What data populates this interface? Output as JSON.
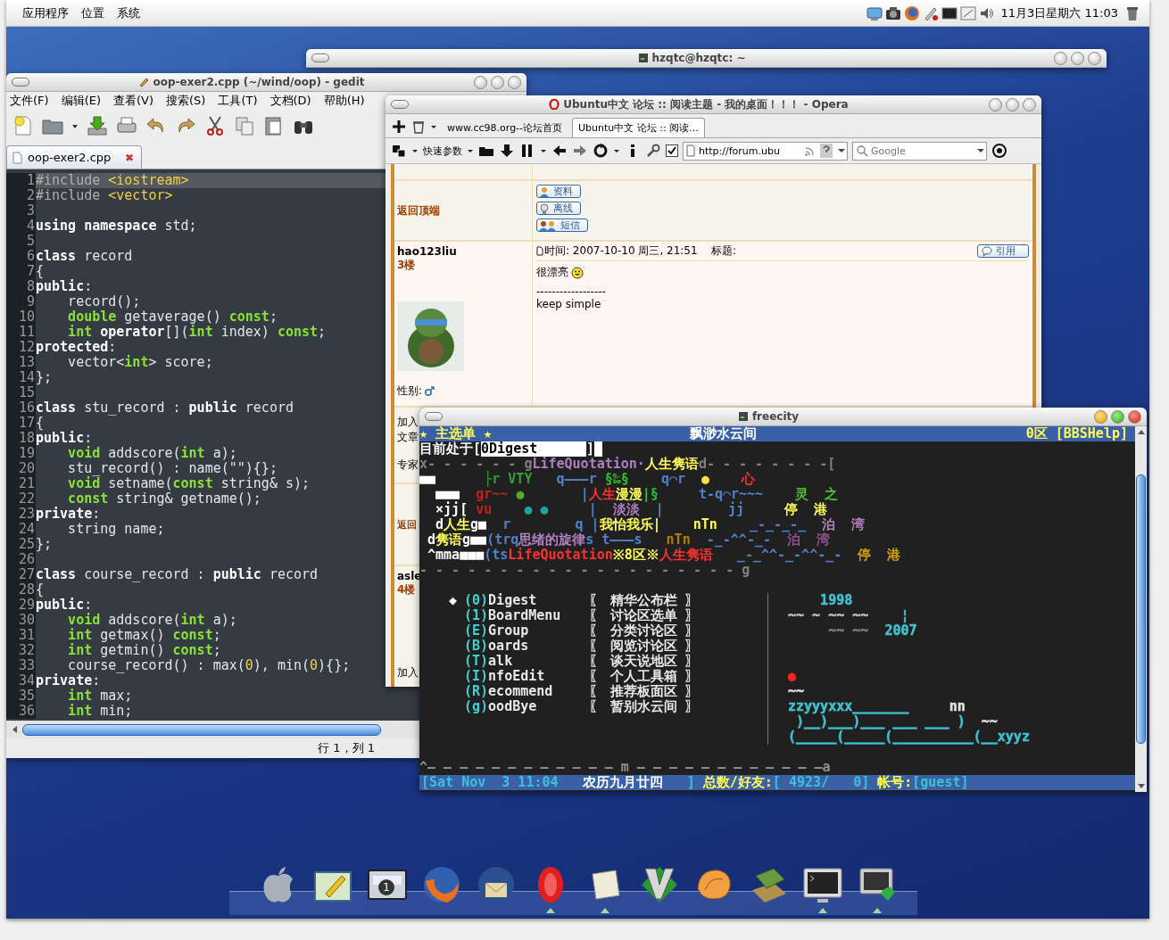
{
  "top_panel": {
    "menus": [
      "应用程序",
      "位置",
      "系统"
    ],
    "clock": "11月3日星期六 11:03"
  },
  "back_terminal": {
    "title": "hzqtc@hzqtc: ~"
  },
  "gedit": {
    "title": "oop-exer2.cpp (~/wind/oop) - gedit",
    "menus": [
      "文件(F)",
      "编辑(E)",
      "查看(V)",
      "搜索(S)",
      "工具(T)",
      "文档(D)",
      "帮助(H)"
    ],
    "tab": {
      "label": "oop-exer2.cpp",
      "close": "✖"
    },
    "lines": [
      {
        "number": "1",
        "segments": [
          {
            "text": "#include ",
            "kind": "preproc"
          },
          {
            "text": "<iostream>",
            "kind": "header"
          }
        ]
      },
      {
        "number": "2",
        "segments": [
          {
            "text": "#include ",
            "kind": "preproc"
          },
          {
            "text": "<vector>",
            "kind": "header"
          }
        ]
      },
      {
        "number": "3"
      },
      {
        "number": "4",
        "segments": [
          {
            "text": "using namespace",
            "kind": "keyword"
          },
          {
            "text": " std;",
            "kind": "plain"
          }
        ]
      },
      {
        "number": "5"
      },
      {
        "number": "6",
        "segments": [
          {
            "text": "class",
            "kind": "keyword"
          },
          {
            "text": " record",
            "kind": "plain"
          }
        ]
      },
      {
        "number": "7",
        "segments": [
          {
            "text": "{",
            "kind": "plain"
          }
        ]
      },
      {
        "number": "8",
        "segments": [
          {
            "text": "public",
            "kind": "keyword"
          },
          {
            "text": ":",
            "kind": "plain"
          }
        ]
      },
      {
        "number": "9",
        "segments": [
          {
            "text": "    record();",
            "kind": "plain"
          }
        ]
      },
      {
        "number": "10",
        "segments": [
          {
            "text": "    double",
            "kind": "type"
          },
          {
            "text": " getaverage() ",
            "kind": "plain"
          },
          {
            "text": "const",
            "kind": "type"
          },
          {
            "text": ";",
            "kind": "plain"
          }
        ]
      },
      {
        "number": "11",
        "segments": [
          {
            "text": "    int",
            "kind": "type"
          },
          {
            "text": " operator",
            "kind": "keyword"
          },
          {
            "text": "[](",
            "kind": "plain"
          },
          {
            "text": "int",
            "kind": "type"
          },
          {
            "text": " index) ",
            "kind": "plain"
          },
          {
            "text": "const",
            "kind": "type"
          },
          {
            "text": ";",
            "kind": "plain"
          }
        ]
      },
      {
        "number": "12",
        "segments": [
          {
            "text": "protected",
            "kind": "keyword"
          },
          {
            "text": ":",
            "kind": "plain"
          }
        ]
      },
      {
        "number": "13",
        "segments": [
          {
            "text": "    vector<",
            "kind": "plain"
          },
          {
            "text": "int",
            "kind": "type"
          },
          {
            "text": "> score;",
            "kind": "plain"
          }
        ]
      },
      {
        "number": "14",
        "segments": [
          {
            "text": "};",
            "kind": "plain"
          }
        ]
      },
      {
        "number": "15"
      },
      {
        "number": "16",
        "segments": [
          {
            "text": "class",
            "kind": "keyword"
          },
          {
            "text": " stu_record : ",
            "kind": "plain"
          },
          {
            "text": "public",
            "kind": "keyword"
          },
          {
            "text": " record",
            "kind": "plain"
          }
        ]
      },
      {
        "number": "17",
        "segments": [
          {
            "text": "{",
            "kind": "plain"
          }
        ]
      },
      {
        "number": "18",
        "segments": [
          {
            "text": "public",
            "kind": "keyword"
          },
          {
            "text": ":",
            "kind": "plain"
          }
        ]
      },
      {
        "number": "19",
        "segments": [
          {
            "text": "    void",
            "kind": "type"
          },
          {
            "text": " addscore(",
            "kind": "plain"
          },
          {
            "text": "int",
            "kind": "type"
          },
          {
            "text": " a);",
            "kind": "plain"
          }
        ]
      },
      {
        "number": "20",
        "segments": [
          {
            "text": "    stu_record() : name(\"\"){};",
            "kind": "plain"
          }
        ]
      },
      {
        "number": "21",
        "segments": [
          {
            "text": "    void",
            "kind": "type"
          },
          {
            "text": " setname(",
            "kind": "plain"
          },
          {
            "text": "const",
            "kind": "type"
          },
          {
            "text": " string& s);",
            "kind": "plain"
          }
        ]
      },
      {
        "number": "22",
        "segments": [
          {
            "text": "    const",
            "kind": "type"
          },
          {
            "text": " string& getname();",
            "kind": "plain"
          }
        ]
      },
      {
        "number": "23",
        "segments": [
          {
            "text": "private",
            "kind": "keyword"
          },
          {
            "text": ":",
            "kind": "plain"
          }
        ]
      },
      {
        "number": "24",
        "segments": [
          {
            "text": "    string name;",
            "kind": "plain"
          }
        ]
      },
      {
        "number": "25",
        "segments": [
          {
            "text": "};",
            "kind": "plain"
          }
        ]
      },
      {
        "number": "26"
      },
      {
        "number": "27",
        "segments": [
          {
            "text": "class",
            "kind": "keyword"
          },
          {
            "text": " course_record : ",
            "kind": "plain"
          },
          {
            "text": "public",
            "kind": "keyword"
          },
          {
            "text": " record",
            "kind": "plain"
          }
        ]
      },
      {
        "number": "28",
        "segments": [
          {
            "text": "{",
            "kind": "plain"
          }
        ]
      },
      {
        "number": "29",
        "segments": [
          {
            "text": "public",
            "kind": "keyword"
          },
          {
            "text": ":",
            "kind": "plain"
          }
        ]
      },
      {
        "number": "30",
        "segments": [
          {
            "text": "    void",
            "kind": "type"
          },
          {
            "text": " addscore(",
            "kind": "plain"
          },
          {
            "text": "int",
            "kind": "type"
          },
          {
            "text": " a);",
            "kind": "plain"
          }
        ]
      },
      {
        "number": "31",
        "segments": [
          {
            "text": "    int",
            "kind": "type"
          },
          {
            "text": " getmax() ",
            "kind": "plain"
          },
          {
            "text": "const",
            "kind": "type"
          },
          {
            "text": ";",
            "kind": "plain"
          }
        ]
      },
      {
        "number": "32",
        "segments": [
          {
            "text": "    int",
            "kind": "type"
          },
          {
            "text": " getmin() ",
            "kind": "plain"
          },
          {
            "text": "const",
            "kind": "type"
          },
          {
            "text": ";",
            "kind": "plain"
          }
        ]
      },
      {
        "number": "33",
        "segments": [
          {
            "text": "    course_record() : max(",
            "kind": "plain"
          },
          {
            "text": "0",
            "kind": "number"
          },
          {
            "text": "), min(",
            "kind": "plain"
          },
          {
            "text": "0",
            "kind": "number"
          },
          {
            "text": "){};",
            "kind": "plain"
          }
        ]
      },
      {
        "number": "34",
        "segments": [
          {
            "text": "private",
            "kind": "keyword"
          },
          {
            "text": ":",
            "kind": "plain"
          }
        ]
      },
      {
        "number": "35",
        "segments": [
          {
            "text": "    int",
            "kind": "type"
          },
          {
            "text": " max;",
            "kind": "plain"
          }
        ]
      },
      {
        "number": "36",
        "segments": [
          {
            "text": "    int",
            "kind": "type"
          },
          {
            "text": " min;",
            "kind": "plain"
          }
        ]
      }
    ],
    "status": {
      "position": "行 1，列 1"
    }
  },
  "opera": {
    "title": "Ubuntu中文 论坛 :: 阅读主题 - 我的桌面！！！ - Opera",
    "tabs": [
      {
        "label": "www.cc98.org--论坛首页",
        "selected": false
      },
      {
        "label": "Ubuntu中文 论坛 :: 阅读...",
        "selected": true
      }
    ],
    "quick_prefs": "快速参数",
    "checkbox_checked": true,
    "address": "http://forum.ubu",
    "search_placeholder": "Google",
    "back_to_top": "返回顶端",
    "profile_buttons": [
      "资料",
      "离线",
      "短信"
    ],
    "post": {
      "author": "hao123liu",
      "floor": "3楼",
      "gender_label": "性别:",
      "header": "时间: 2007-10-10 周三, 21:51    标题:",
      "quote": "引用",
      "body": "很漂亮",
      "signature_rule": "------------------",
      "signature": "keep simple"
    },
    "left_fragments": [
      "加入",
      "文章",
      "专家"
    ],
    "back_to_top_cut": "返回",
    "next_author": "asle",
    "next_floor": "4楼",
    "joined_cut": "加入"
  },
  "bbs": {
    "title": "freecity",
    "header": {
      "left": "★ 主选单 ★",
      "center": "飘渺水云间",
      "right": "0区 [BBSHelp]"
    },
    "location": {
      "prefix": "目前处于[",
      "value": "0Digest",
      "suffix": "]"
    },
    "art_lines": [
      [
        {
          "text": "x- - - - - - g",
          "color": "#808080"
        },
        {
          "text": "LifeQuotation·",
          "color": "#b080c0"
        },
        {
          "text": "人生隽语",
          "color": "#ffff55"
        },
        {
          "text": "d- - - - - - - -[",
          "color": "#808080"
        }
      ],
      [
        {
          "text": "■■      ",
          "color": "#ffffff"
        },
        {
          "text": "├r VTY   ",
          "color": "#30a030"
        },
        {
          "text": "q———r ",
          "color": "#5080d0"
        },
        {
          "text": "§‰§    ",
          "color": "#30c030"
        },
        {
          "text": "q⌒r  ",
          "color": "#5080d0"
        },
        {
          "text": "●    ",
          "color": "#ffe040"
        },
        {
          "text": "心",
          "color": "#ff3030"
        }
      ],
      [
        {
          "text": "  ■■■  ",
          "color": "#ffffff"
        },
        {
          "text": "gr~~ ",
          "color": "#c02020"
        },
        {
          "text": "●       ",
          "color": "#50b020"
        },
        {
          "text": "|",
          "color": "#5080d0"
        },
        {
          "text": "人生",
          "color": "#ff3030"
        },
        {
          "text": "漫漫",
          "color": "#ffff55"
        },
        {
          "text": "|§     ",
          "color": "#30c030"
        },
        {
          "text": "t-q⌒r~~~    ",
          "color": "#5080d0"
        },
        {
          "text": "灵  之",
          "color": "#50c030"
        }
      ],
      [
        {
          "text": "  ×jj[ ",
          "color": "#ffffff"
        },
        {
          "text": "vu    ",
          "color": "#c02020"
        },
        {
          "text": "● ●     ",
          "color": "#20a0a0"
        },
        {
          "text": "|  ",
          "color": "#5080d0"
        },
        {
          "text": "淡淡  ",
          "color": "#b080c0"
        },
        {
          "text": "|        jj     ",
          "color": "#5080d0"
        },
        {
          "text": "停  港",
          "color": "#ffff55"
        }
      ],
      [
        {
          "text": "  d",
          "color": "#ffffff"
        },
        {
          "text": "人生",
          "color": "#ffff55"
        },
        {
          "text": "g■  ",
          "color": "#ffffff"
        },
        {
          "text": "r        q |",
          "color": "#5080d0"
        },
        {
          "text": "我怡我乐",
          "color": "#ffff55"
        },
        {
          "text": "|    nTn    ",
          "color": "#ffff55"
        },
        {
          "text": "_-_-_-_  ",
          "color": "#5080d0"
        },
        {
          "text": "泊  湾",
          "color": "#b080c0"
        }
      ],
      [
        {
          "text": " d",
          "color": "#ffffff"
        },
        {
          "text": "隽语",
          "color": "#ffff55"
        },
        {
          "text": "g■■",
          "color": "#ffffff"
        },
        {
          "text": "(trq",
          "color": "#5080d0"
        },
        {
          "text": "思绪的旋律",
          "color": "#b080c0"
        },
        {
          "text": "s t———s   ",
          "color": "#5080d0"
        },
        {
          "text": "nTn  ",
          "color": "#b08000"
        },
        {
          "text": "-_-^^-_-  ",
          "color": "#5080d0"
        },
        {
          "text": "泊  湾",
          "color": "#905090"
        }
      ],
      [
        {
          "text": " ^mma■■■",
          "color": "#ffffff"
        },
        {
          "text": "(ts",
          "color": "#5080d0"
        },
        {
          "text": "LifeQuotation",
          "color": "#ff3030"
        },
        {
          "text": "※8区※",
          "color": "#ffff55"
        },
        {
          "text": "人生隽语",
          "color": "#ff3030"
        },
        {
          "text": "   _-_^^-_-^^-_-  ",
          "color": "#5080d0"
        },
        {
          "text": "停  港",
          "color": "#d0a000"
        }
      ],
      [
        {
          "text": "- - - - - - - - - - - - - - - - - - - - g",
          "color": "#808080"
        }
      ]
    ],
    "menu_marker": "◆",
    "menu": [
      {
        "key": "(0)",
        "label": "Digest",
        "description": "〖 精华公布栏 〗",
        "selected": true,
        "art": [
          {
            "text": "    1998",
            "color": "#40c0d0"
          }
        ]
      },
      {
        "key": "(1)",
        "label": "BoardMenu",
        "description": "〖 讨论区选单 〗",
        "selected": false,
        "art": [
          {
            "text": "~~ ~ ~~ ~~    ",
            "color": "#c0c0c0"
          },
          {
            "text": "¦",
            "color": "#40c0d0"
          }
        ]
      },
      {
        "key": "(E)",
        "label": "Group",
        "description": "〖 分类讨论区 〗",
        "selected": false,
        "art": [
          {
            "text": "     ~~ ~~  ",
            "color": "#808080"
          },
          {
            "text": "2007",
            "color": "#40c0d0"
          }
        ]
      },
      {
        "key": "(B)",
        "label": "oards",
        "description": "〖 阅览讨论区 〗",
        "selected": false
      },
      {
        "key": "(T)",
        "label": "alk",
        "description": "〖 谈天说地区 〗",
        "selected": false
      },
      {
        "key": "(I)",
        "label": "nfoEdit",
        "description": "〖 个人工具箱 〗",
        "selected": false,
        "art": [
          {
            "text": "●",
            "color": "#ff2020"
          }
        ]
      },
      {
        "key": "(R)",
        "label": "ecommend",
        "description": "〖 推荐板面区 〗",
        "selected": false,
        "art": [
          {
            "text": "~~",
            "color": "#e0e0e0"
          }
        ]
      },
      {
        "key": "(g)",
        "label": "oodBye",
        "description": "〖 暂别水云间 〗",
        "selected": false,
        "art": [
          {
            "text": "zzyyyxxx_______     ",
            "color": "#40c0d0"
          },
          {
            "text": "nn",
            "color": "#e0e0e0"
          }
        ]
      }
    ],
    "footer_art": [
      [
        {
          "text": " )__)___)___ ___ ___ )  ",
          "color": "#40c0d0"
        },
        {
          "text": "~~",
          "color": "#e0e0e0"
        }
      ],
      [
        {
          "text": "(_____(_____(__________(__xyyz",
          "color": "#40c0d0"
        }
      ]
    ],
    "divider": "^— — — — — — — — — — — — m — — — — — — — — — — — —a",
    "status": [
      {
        "text": "[Sat Nov  3 11:04",
        "kind": "value"
      },
      {
        "text": "   农历九月廿四   ",
        "kind": "lunar"
      },
      {
        "text": "] ",
        "kind": "value"
      },
      {
        "text": "总数/好友:",
        "kind": "label"
      },
      {
        "text": "[ 4923/   0] ",
        "kind": "value"
      },
      {
        "text": "帐号:",
        "kind": "label"
      },
      {
        "text": "[guest]",
        "kind": "value"
      }
    ]
  },
  "dock": {
    "items": [
      {
        "kind": "apple",
        "running": false
      },
      {
        "kind": "editor",
        "running": false
      },
      {
        "kind": "workspaces",
        "running": false,
        "badge": "1"
      },
      {
        "kind": "fox",
        "running": false
      },
      {
        "kind": "mailbird",
        "running": false
      },
      {
        "kind": "letter_o",
        "running": true
      },
      {
        "kind": "note",
        "running": true
      },
      {
        "kind": "letter_v",
        "running": false
      },
      {
        "kind": "shell",
        "running": false
      },
      {
        "kind": "books",
        "running": false
      },
      {
        "kind": "monitor",
        "running": true
      },
      {
        "kind": "monitor_gem",
        "running": true
      }
    ]
  }
}
